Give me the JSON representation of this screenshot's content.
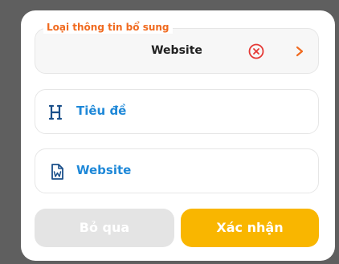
{
  "dialog": {
    "type_field": {
      "legend": "Loại thông tin bổ sung",
      "value": "Website",
      "clear_icon": "close-circle-icon",
      "chevron_icon": "chevron-right-icon"
    },
    "fields": [
      {
        "label": "Tiêu đề",
        "icon": "heading-icon"
      },
      {
        "label": "Website",
        "icon": "word-document-icon"
      }
    ],
    "buttons": {
      "skip": "Bỏ qua",
      "confirm": "Xác nhận"
    }
  },
  "colors": {
    "accent_orange": "#f06a1f",
    "link_blue": "#1e88d8",
    "confirm_yellow": "#f9b600",
    "skip_gray": "#e4e4e4",
    "clear_red": "#e53935"
  }
}
